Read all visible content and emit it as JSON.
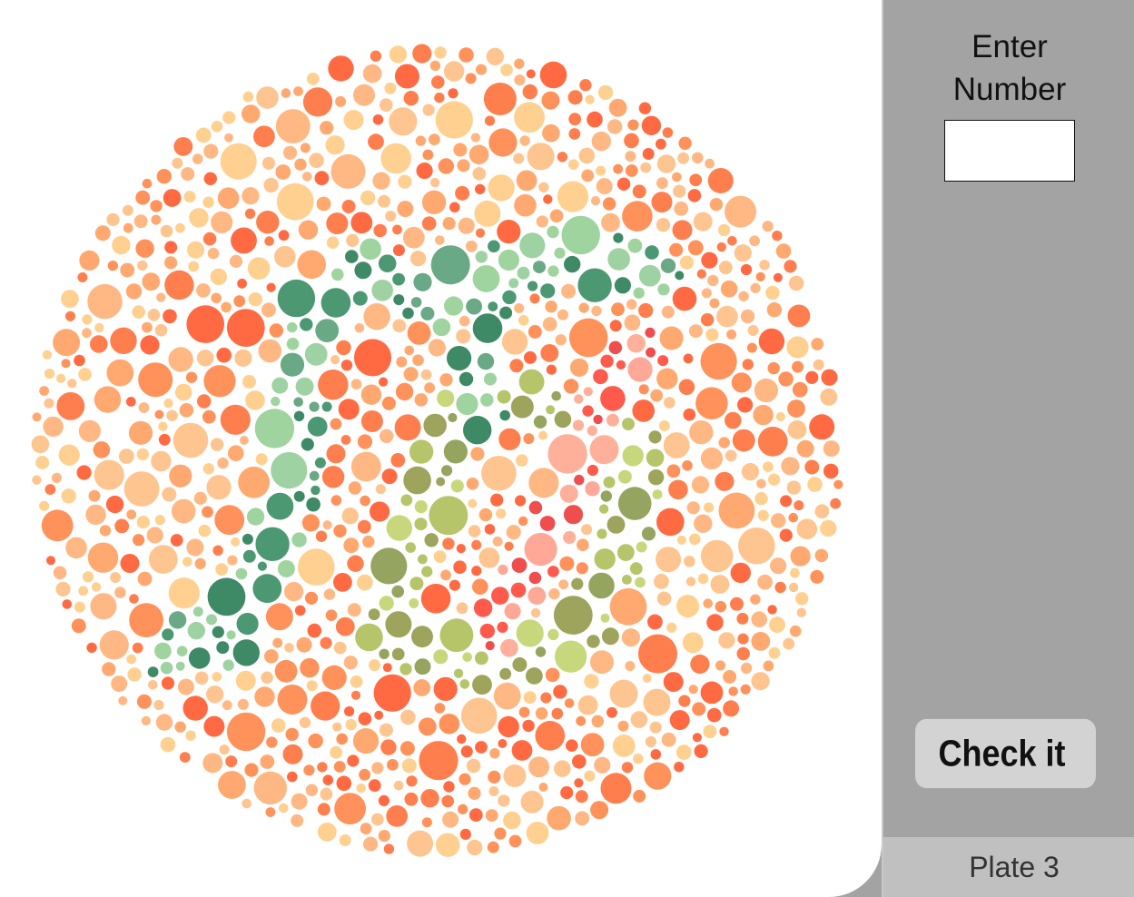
{
  "test": {
    "plate_label": "Plate 3",
    "prompt_line1": "Enter",
    "prompt_line2": "Number",
    "answer_input": {
      "value": "",
      "placeholder": ""
    },
    "check_label": "Check it"
  },
  "plate": {
    "palette": {
      "background_dots": [
        "#ffd090",
        "#ffc590",
        "#ffb884",
        "#ffa970",
        "#ff925a",
        "#ff7e4e",
        "#ff6a42"
      ],
      "figure_green": [
        "#4b9873",
        "#3f8a66",
        "#6aa985",
        "#9fd49f",
        "#9ed2a2"
      ],
      "figure_olive": [
        "#c7d87c",
        "#b6c46a",
        "#9ea45c",
        "#95a45e"
      ],
      "figure_red": [
        "#ee4e4e",
        "#ff5a4c",
        "#ffb09a",
        "#ffa898"
      ]
    }
  }
}
